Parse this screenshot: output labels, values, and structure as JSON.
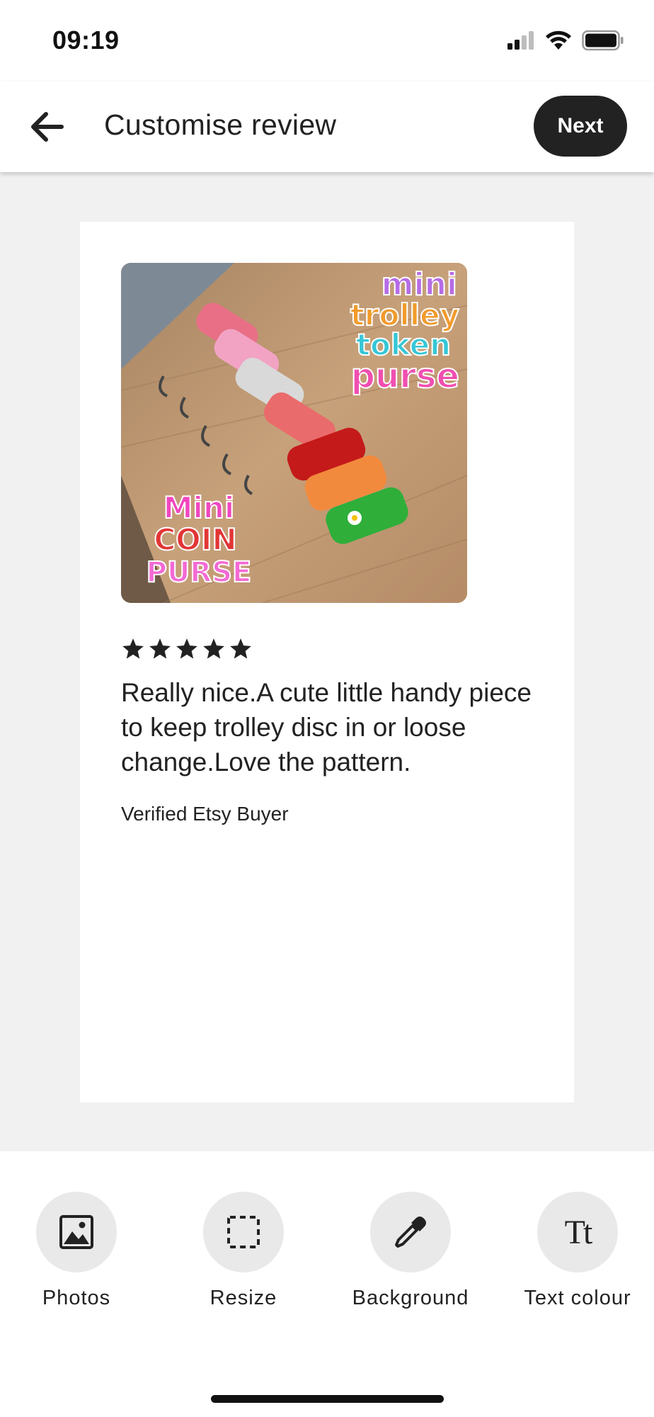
{
  "status_bar": {
    "time": "09:19",
    "icons": [
      "cellular-signal-icon",
      "wifi-icon",
      "battery-icon"
    ]
  },
  "header": {
    "back_icon": "arrow-left-icon",
    "title": "Customise review",
    "next_label": "Next"
  },
  "review": {
    "photo_text_top": [
      "mini",
      "trolley",
      "token",
      "purse"
    ],
    "photo_text_bottom": [
      "Mini",
      "COIN",
      "PURSE"
    ],
    "rating": 5,
    "rating_max": 5,
    "text": "Really nice.A cute little handy piece to keep trolley disc in or loose change.Love the pattern.",
    "reviewer": "Verified Etsy Buyer"
  },
  "toolbar": {
    "photos_label": "Photos",
    "resize_label": "Resize",
    "background_label": "Background",
    "text_colour_label": "Text colour",
    "text_colour_icon_glyph": "Tt"
  },
  "colors": {
    "accent_dark": "#222222",
    "canvas_bg": "#f1f1f1",
    "tool_circle_bg": "#e9e9e9"
  }
}
